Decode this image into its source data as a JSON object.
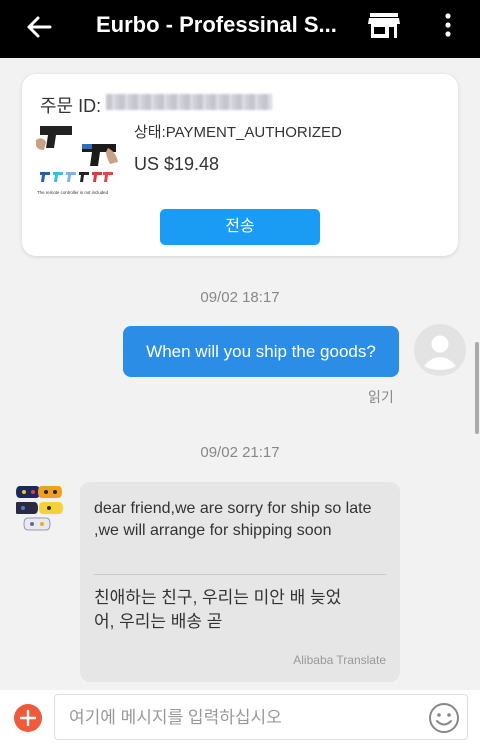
{
  "header": {
    "title": "Eurbo - Professinal S...",
    "back_icon": "arrow-left-icon",
    "store_icon": "store-icon",
    "more_icon": "more-vertical-icon"
  },
  "order": {
    "id_label": "주문 ID:",
    "status": "상태:PAYMENT_AUTHORIZED",
    "price": "US $19.48",
    "send_label": "전송",
    "image_caption": "The remote controller is not included"
  },
  "messages": [
    {
      "timestamp": "09/02 18:17",
      "text": "When will you ship the goods?",
      "read_status": "읽기"
    },
    {
      "timestamp": "09/02 21:17",
      "original": "dear friend,we are sorry for ship so late ,we will arrange for shipping soon",
      "translated": "친애하는 친구, 우리는 미안 배 늦었어, 우리는 배송 곧",
      "translate_credit": "Alibaba Translate"
    }
  ],
  "composer": {
    "placeholder": "여기에 메시지를 입력하십시오",
    "plus_icon": "plus-icon",
    "emoji_icon": "emoji-icon"
  },
  "colors": {
    "header_bg": "#000000",
    "accent": "#1a9cf4",
    "outgoing_bubble": "#2b8de6",
    "incoming_bubble": "#e6e6e6",
    "plus_button": "#f05a3c",
    "background": "#f2f2f2"
  }
}
